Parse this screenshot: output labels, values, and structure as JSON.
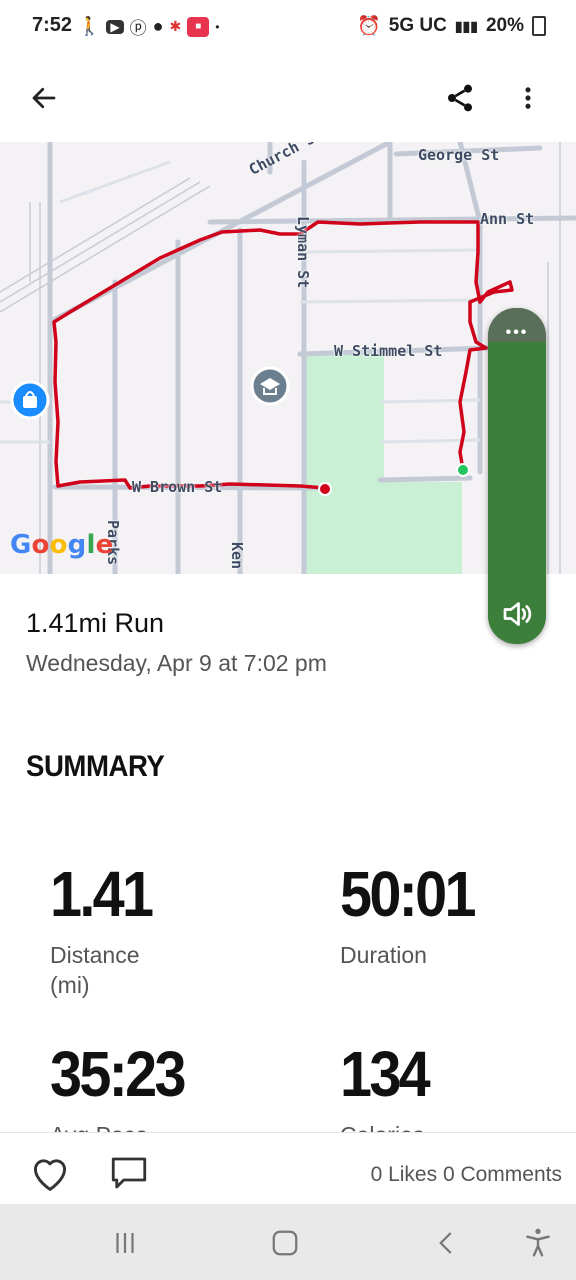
{
  "status_bar": {
    "time": "7:52",
    "network": "5G UC",
    "battery": "20%"
  },
  "app_bar": {
    "back_icon": "arrow-left-icon",
    "share_icon": "share-icon",
    "more_icon": "more-vert-icon"
  },
  "map": {
    "labels": {
      "church": "Church St",
      "george": "George St",
      "ann": "Ann St",
      "lyman": "Lyman St",
      "stimmel": "W Stimmel St",
      "brown": "W Brown St",
      "parks": "Parks",
      "ken": "Ken"
    },
    "google_logo": "Google",
    "route_color": "#d0021b",
    "park_color": "#c9f0d4"
  },
  "workout": {
    "title": "1.41mi Run",
    "date": "Wednesday, Apr 9 at 7:02 pm"
  },
  "summary": {
    "heading": "SUMMARY",
    "stats": [
      {
        "value": "1.41",
        "label_line1": "Distance",
        "label_line2": "(mi)"
      },
      {
        "value": "50:01",
        "label_line1": "Duration",
        "label_line2": ""
      },
      {
        "value": "35:23",
        "label_line1": "Avg Pace",
        "label_line2": ""
      },
      {
        "value": "134",
        "label_line1": "Calories",
        "label_line2": ""
      }
    ]
  },
  "footer": {
    "likes_comments": "0 Likes 0 Comments"
  },
  "side_panel": {
    "dots": "•••",
    "icon": "volume-icon",
    "color": "#3b7f3b"
  }
}
